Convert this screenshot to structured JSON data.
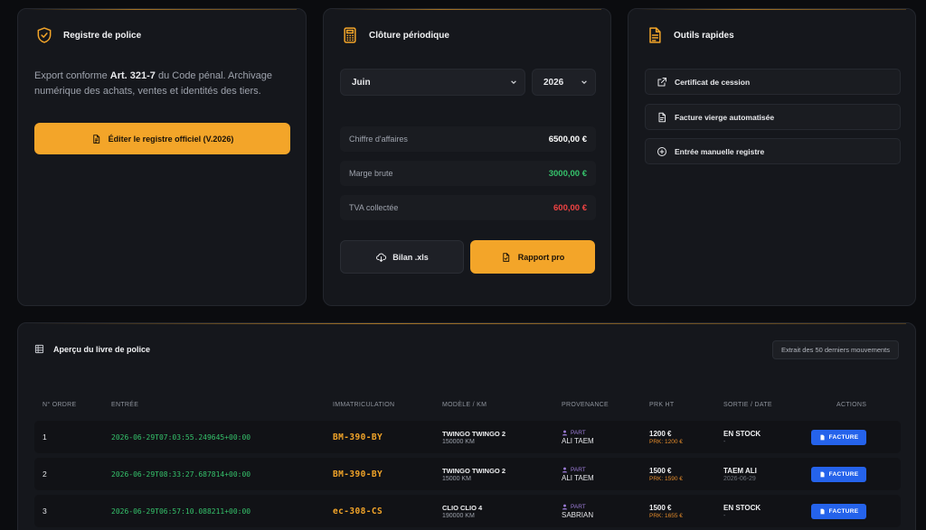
{
  "registre": {
    "title": "Registre de police",
    "desc_prefix": "Export conforme ",
    "desc_bold": "Art. 321-7",
    "desc_suffix": " du Code pénal. Archivage numérique des achats, ventes et identités des tiers.",
    "button_label": "Éditer le registre officiel (V.2026)"
  },
  "cloture": {
    "title": "Clôture périodique",
    "month": "Juin",
    "year": "2026",
    "stats": [
      {
        "label": "Chiffre d'affaires",
        "value": "6500,00 €",
        "color": "#ffffff"
      },
      {
        "label": "Marge brute",
        "value": "3000,00 €",
        "color": "#35c26b"
      },
      {
        "label": "TVA collectée",
        "value": "600,00 €",
        "color": "#ef4343"
      }
    ],
    "bilan_label": "Bilan .xls",
    "rapport_label": "Rapport pro"
  },
  "outils": {
    "title": "Outils rapides",
    "items": [
      {
        "label": "Certificat de cession",
        "icon": "external-link-icon"
      },
      {
        "label": "Facture vierge automatisée",
        "icon": "document-icon"
      },
      {
        "label": "Entrée manuelle registre",
        "icon": "plus-circle-icon"
      }
    ]
  },
  "livre": {
    "title": "Aperçu du livre de police",
    "badge": "Extrait des 50 derniers mouvements",
    "headers": {
      "order": "N° ORDRE",
      "entry": "ENTRÉE",
      "plate": "IMMATRICULATION",
      "model": "MODÈLE / KM",
      "prov": "PROVENANCE",
      "price": "PRK HT",
      "exit": "SORTIE / DATE",
      "actions": "ACTIONS"
    },
    "rows": [
      {
        "order": "1",
        "entry": "2026-06-29T07:03:55.249645+00:00",
        "plate": "BM-390-BY",
        "model": "TWINGO TWINGO 2",
        "km": "150000 KM",
        "prov_type": "PART",
        "prov_name": "ALI TAEM",
        "price": "1200 €",
        "prk": "PRK: 1200 €",
        "exit": "EN STOCK",
        "exit_date": "-",
        "action": "FACTURE"
      },
      {
        "order": "2",
        "entry": "2026-06-29T08:33:27.687814+00:00",
        "plate": "BM-390-BY",
        "model": "TWINGO TWINGO 2",
        "km": "15000 KM",
        "prov_type": "PART",
        "prov_name": "ALI TAEM",
        "price": "1500 €",
        "prk": "PRK: 1590 €",
        "exit": "TAEM ALI",
        "exit_date": "2026-06-29",
        "action": "FACTURE"
      },
      {
        "order": "3",
        "entry": "2026-06-29T06:57:10.088211+00:00",
        "plate": "ec-308-CS",
        "model": "CLIO CLIO 4",
        "km": "190000 KM",
        "prov_type": "PART",
        "prov_name": "SABRIAN",
        "price": "1500 €",
        "prk": "PRK: 1655 €",
        "exit": "EN STOCK",
        "exit_date": "-",
        "action": "FACTURE"
      }
    ]
  },
  "colors": {
    "accent": "#f3a529",
    "background": "#0b0c0f",
    "card": "#15171c",
    "green": "#35c26b",
    "red": "#ef4343",
    "blue": "#2563eb"
  }
}
